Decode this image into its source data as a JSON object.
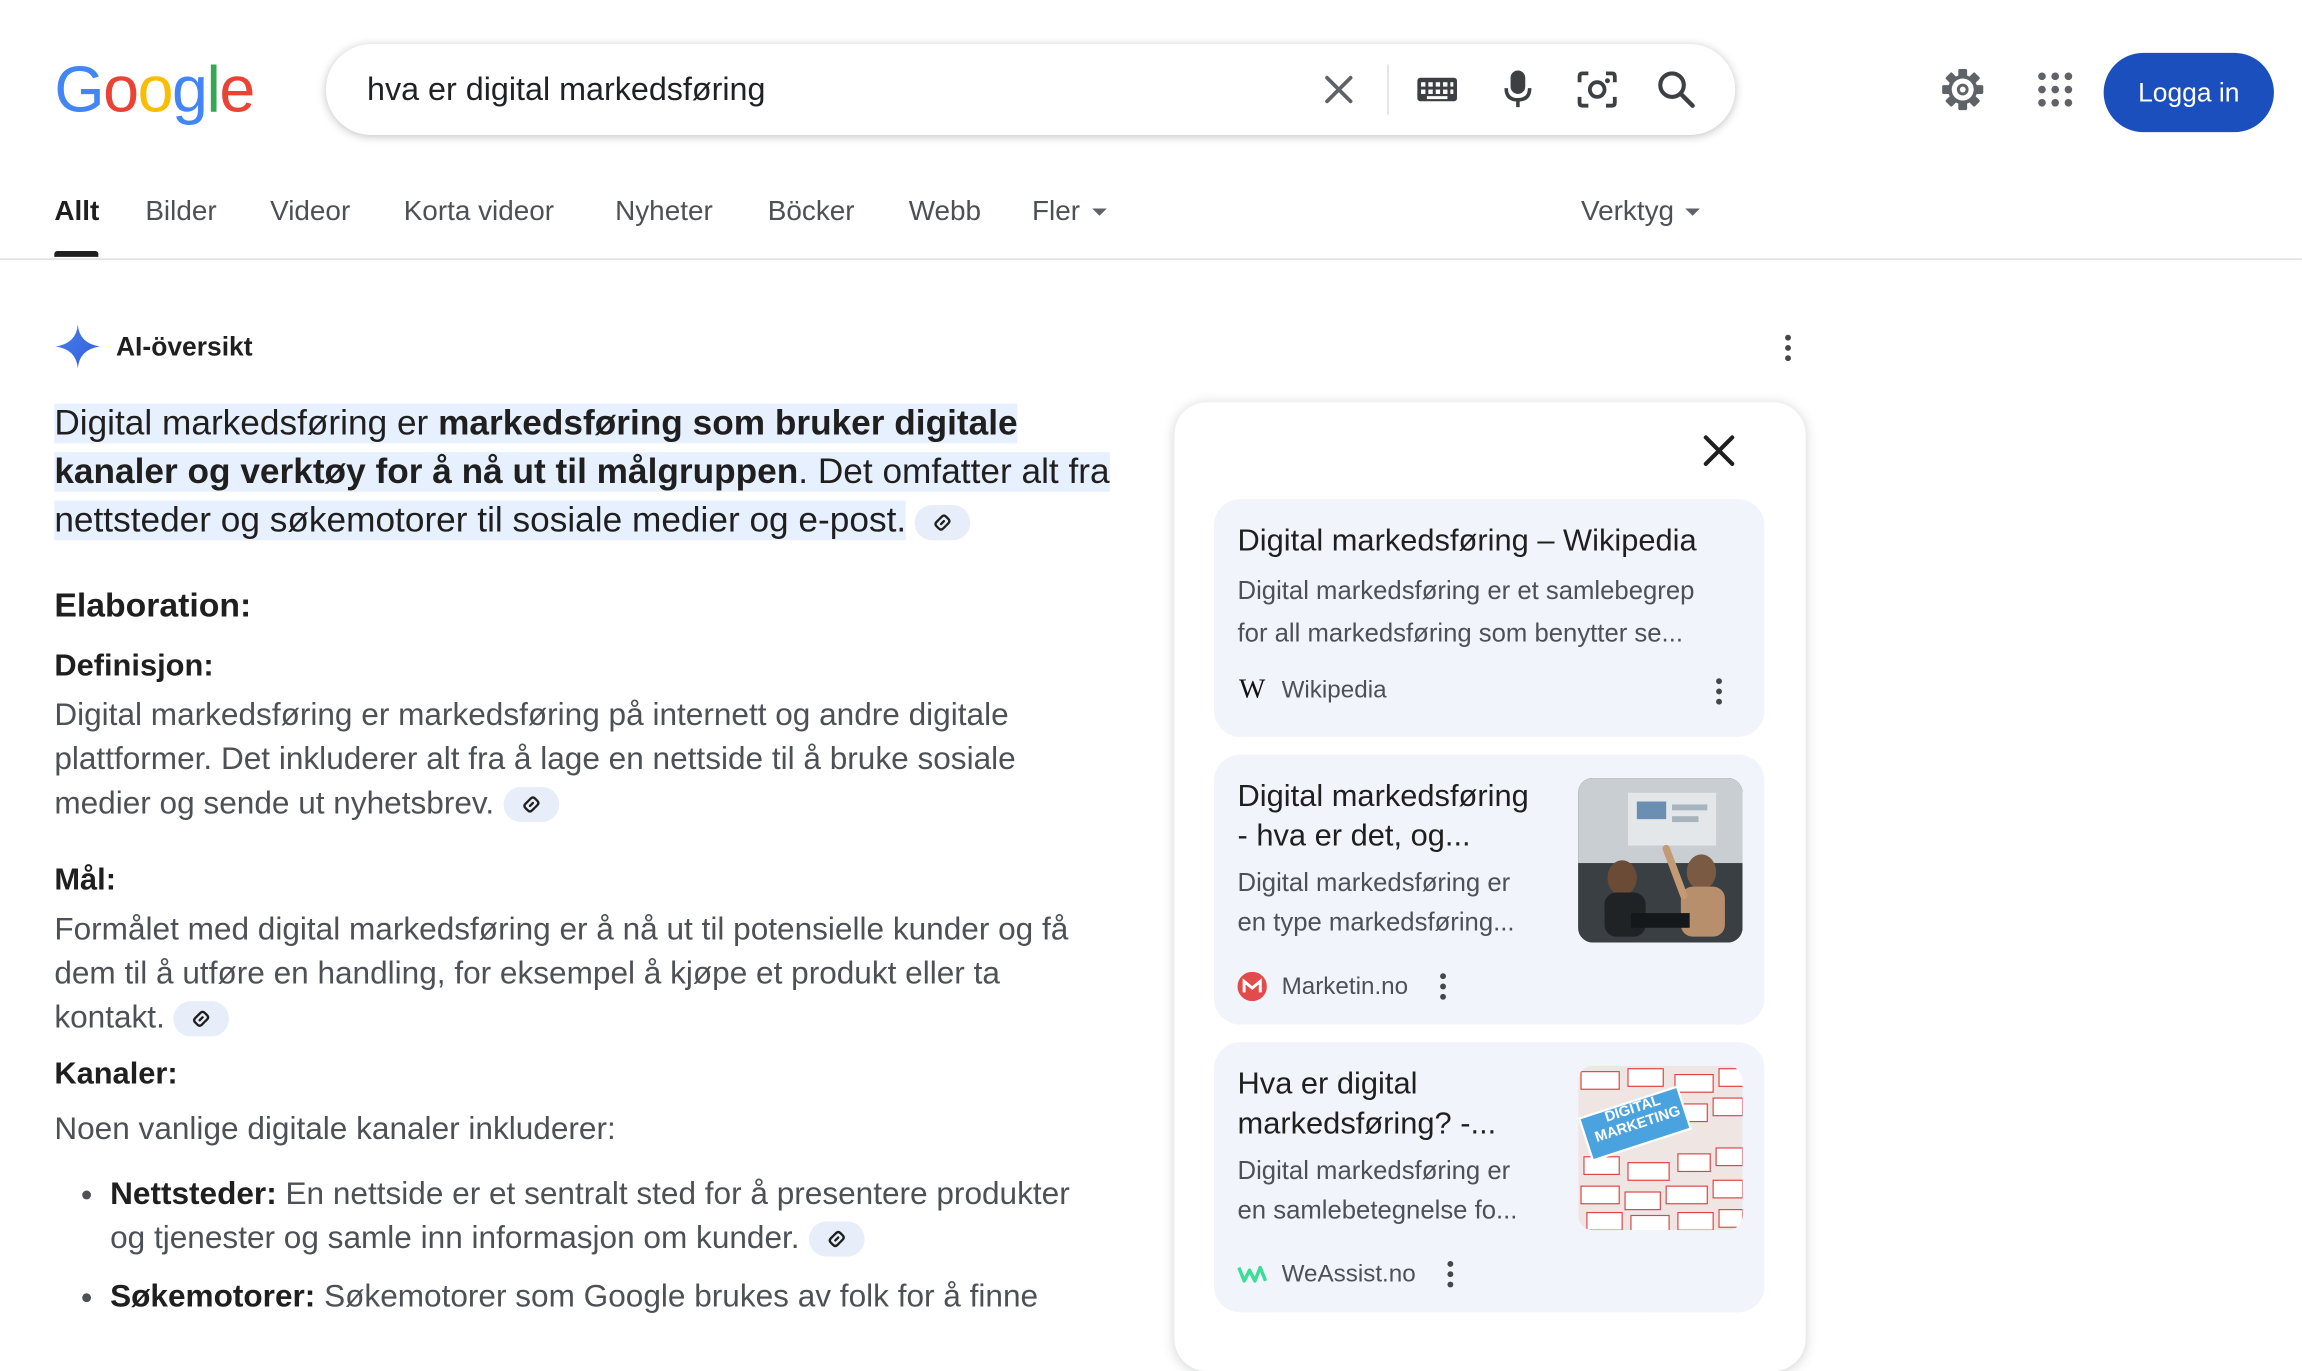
{
  "logo": {
    "text": "Google"
  },
  "search": {
    "query": "hva er digital markedsføring"
  },
  "header": {
    "login_label": "Logga in"
  },
  "tabs": {
    "items": [
      "Allt",
      "Bilder",
      "Videor",
      "Korta videor",
      "Nyheter",
      "Böcker",
      "Webb",
      "Fler"
    ],
    "tools": "Verktyg",
    "active": "Allt"
  },
  "ai": {
    "label": "AI-översikt",
    "summary_pre": "Digital markedsføring er ",
    "summary_bold": "markedsføring som bruker digitale kanaler og verktøy for å nå ut til målgruppen",
    "summary_post": ". Det omfatter alt fra nettsteder og søkemotorer til sosiale medier og e-post.",
    "elaboration": "Elaboration:",
    "def_title": "Definisjon:",
    "def_text": "Digital markedsføring er markedsføring på internett og andre digitale plattformer. Det inkluderer alt fra å lage en nettside til å bruke sosiale medier og sende ut nyhetsbrev.",
    "goal_title": "Mål:",
    "goal_text": "Formålet med digital markedsføring er å nå ut til potensielle kunder og få dem til å utføre en handling, for eksempel å kjøpe et produkt eller ta kontakt.",
    "channels_title": "Kanaler:",
    "channels_intro": "Noen vanlige digitale kanaler inkluderer:",
    "bullets": [
      {
        "term": "Nettsteder:",
        "text": " En nettside er et sentralt sted for å presentere produkter og tjenester og samle inn informasjon om kunder."
      },
      {
        "term": "Søkemotorer:",
        "text": " Søkemotorer som Google brukes av folk for å finne"
      }
    ]
  },
  "sources": [
    {
      "title": "Digital markedsføring – Wikipedia",
      "snippet1": "Digital markedsføring er et samlebegrep",
      "snippet2": "for all markedsføring som benytter se...",
      "site": "Wikipedia"
    },
    {
      "title1": "Digital markedsføring",
      "title2": "- hva er det, og...",
      "snippet1": "Digital markedsføring er",
      "snippet2": "en type markedsføring...",
      "site": "Marketin.no"
    },
    {
      "title1": "Hva er digital",
      "title2": "markedsføring? -...",
      "snippet1": "Digital markedsføring er",
      "snippet2": "en samlebetegnelse fo...",
      "site": "WeAssist.no",
      "thumb_text": "DIGITAL MARKETING"
    }
  ],
  "colors": {
    "accent": "#1a4fbd",
    "card_bg": "#f1f4fb",
    "highlight": "#d3e3fd"
  }
}
